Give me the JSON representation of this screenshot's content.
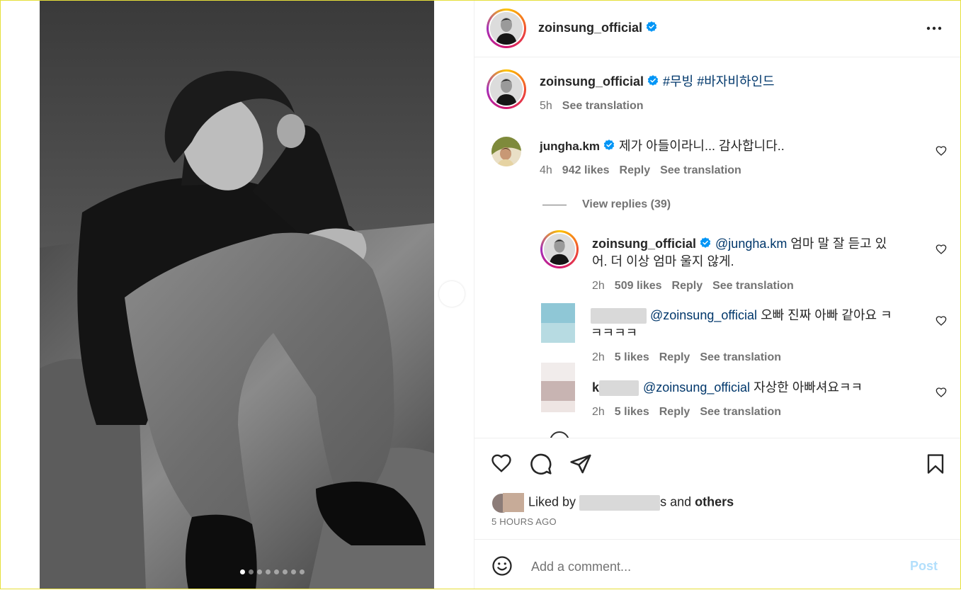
{
  "post": {
    "username": "zoinsung_official",
    "more_icon": "more-horizontal-icon",
    "carousel": {
      "slide_count": 8,
      "active_index": 0
    }
  },
  "caption": {
    "username": "zoinsung_official",
    "hashtag1": "#무빙",
    "hashtag2": "#바자비하인드",
    "time": "5h",
    "see_translation": "See translation"
  },
  "comments": [
    {
      "username": "jungha.km",
      "text": "제가 아들이라니... 감사합니다..",
      "time": "4h",
      "likes": "942 likes",
      "reply": "Reply",
      "see_translation": "See translation",
      "view_replies": "View replies (39)"
    }
  ],
  "replies": [
    {
      "username": "zoinsung_official",
      "mention": "@jungha.km",
      "text_line1": "엄마 말 잘 듣고 있",
      "text_line2": "어. 더 이상 엄마 울지 않게.",
      "time": "2h",
      "likes": "509 likes",
      "reply": "Reply",
      "see_translation": "See translation"
    },
    {
      "username": "",
      "mention": "@zoinsung_official",
      "text_line1": "오빠 진짜 아빠 같아요 ㅋ",
      "text_line2": "ㅋㅋㅋㅋ",
      "time": "2h",
      "likes": "5 likes",
      "reply": "Reply",
      "see_translation": "See translation"
    },
    {
      "username": "k",
      "mention": "@zoinsung_official",
      "text_line1": "자상한 아빠셔요ㅋㅋ",
      "time": "2h",
      "likes": "5 likes",
      "reply": "Reply",
      "see_translation": "See translation"
    }
  ],
  "actions": {
    "liked_prefix": "Liked by",
    "liked_suffix_letter": "s",
    "liked_and": "and",
    "liked_others": "others",
    "time_ago": "5 HOURS AGO"
  },
  "comment_box": {
    "placeholder": "Add a comment...",
    "post_label": "Post"
  },
  "colors": {
    "link": "#00376b",
    "verified": "#0095f6",
    "muted": "#737373",
    "post_disabled": "#b2dffc"
  }
}
